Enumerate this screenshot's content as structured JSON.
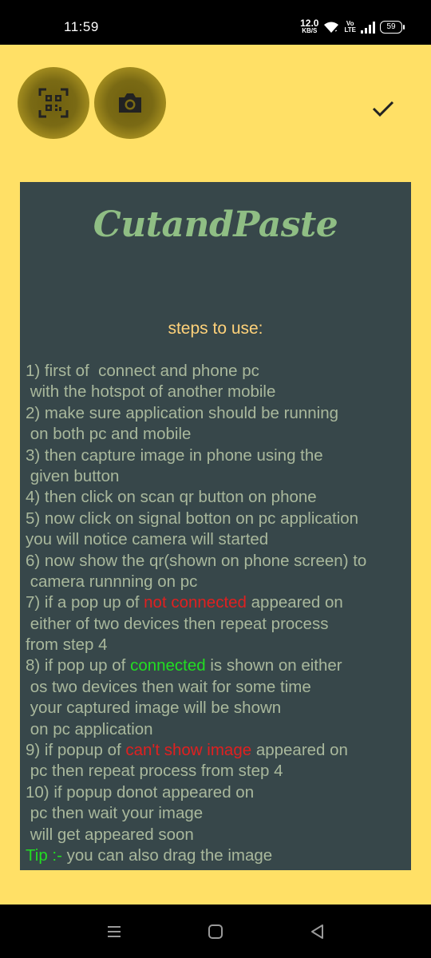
{
  "status_bar": {
    "time": "11:59",
    "speed_value": "12.0",
    "speed_unit": "KB/S",
    "volte_top": "Vo",
    "volte_bottom": "LTE",
    "battery": "59"
  },
  "toolbar": {
    "qr_icon": "qr-code-scan-icon",
    "camera_icon": "camera-icon",
    "check_icon": "checkmark-icon"
  },
  "panel": {
    "title": "CutandPaste",
    "subtitle": "steps to use:",
    "lines": [
      {
        "text": "1) first of  connect and phone pc"
      },
      {
        "text": " with the hotspot of another mobile"
      },
      {
        "text": "2) make sure application should be running"
      },
      {
        "text": " on both pc and mobile"
      },
      {
        "text": "3) then capture image in phone using the"
      },
      {
        "text": " given button"
      },
      {
        "text": "4) then click on scan qr button on phone"
      },
      {
        "text": "5) now click on signal botton on pc application"
      },
      {
        "text": "you will notice camera will started"
      },
      {
        "text": "6) now show the qr(shown on phone screen) to"
      },
      {
        "text": " camera runnning on pc"
      },
      {
        "pre": "7) if a pop up of ",
        "hl": "not connected",
        "hl_color": "red",
        "post": " appeared on"
      },
      {
        "text": " either of two devices then repeat process"
      },
      {
        "text": "from step 4"
      },
      {
        "pre": "8) if pop up of ",
        "hl": "connected",
        "hl_color": "green",
        "post": " is shown on either"
      },
      {
        "text": " os two devices then wait for some time"
      },
      {
        "text": " your captured image will be shown"
      },
      {
        "text": " on pc application"
      },
      {
        "pre": "9) if popup of ",
        "hl": "can't show image",
        "hl_color": "red",
        "post": " appeared on"
      },
      {
        "text": " pc then repeat process from step 4"
      },
      {
        "text": "10) if popup donot appeared on"
      },
      {
        "text": " pc then wait your image"
      },
      {
        "text": " will get appeared soon"
      },
      {
        "pre": "",
        "hl": "Tip :-",
        "hl_color": "green",
        "post": " you can also drag the image"
      }
    ]
  },
  "nav_bar": {
    "recent_icon": "recent-apps-icon",
    "home_icon": "home-icon",
    "back_icon": "back-icon"
  },
  "colors": {
    "background": "#FFE066",
    "panel": "#37474A",
    "title": "#8FBE84",
    "subtitle": "#FFD27A",
    "text": "#A9B89C",
    "red": "#E02020",
    "green": "#22DD22"
  }
}
